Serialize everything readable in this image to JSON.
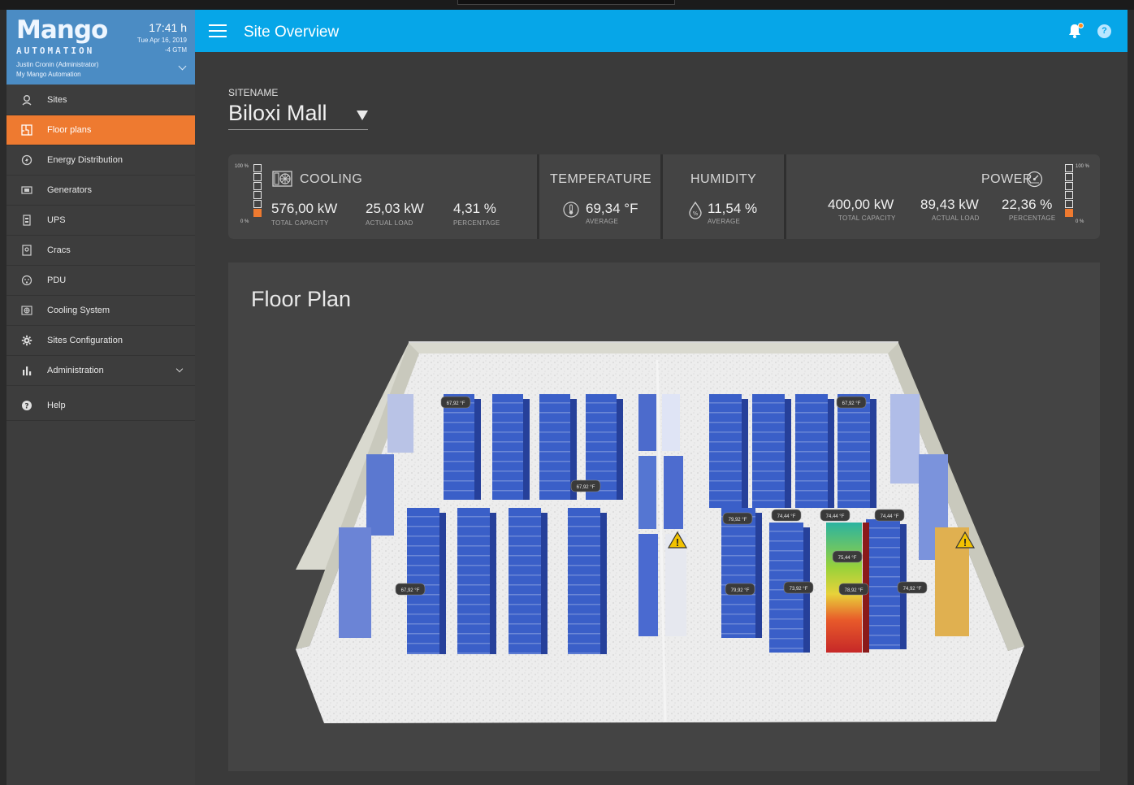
{
  "brand": {
    "logo": "Mango",
    "logo_sub": "AUTOMATION",
    "time": "17:41 h",
    "date": "Tue Apr 16, 2019",
    "timezone": "-4 GTM",
    "user": "Justin Cronin (Administrator)",
    "account": "My Mango Automation"
  },
  "nav": [
    {
      "label": "Sites",
      "icon": "location-pin-icon"
    },
    {
      "label": "Floor plans",
      "icon": "floor-plan-icon",
      "active": true
    },
    {
      "label": "Energy Distribution",
      "icon": "energy-icon"
    },
    {
      "label": "Generators",
      "icon": "generator-icon"
    },
    {
      "label": "UPS",
      "icon": "battery-icon"
    },
    {
      "label": "Cracs",
      "icon": "crac-icon"
    },
    {
      "label": "PDU",
      "icon": "pdu-icon"
    },
    {
      "label": "Cooling System",
      "icon": "cooling-icon"
    },
    {
      "label": "Sites Configuration",
      "icon": "gear-icon"
    },
    {
      "label": "Administration",
      "icon": "bar-chart-icon",
      "expandable": true
    },
    {
      "label": "Help",
      "icon": "help-circle-icon"
    }
  ],
  "header": {
    "title": "Site Overview",
    "help_label": "?"
  },
  "site": {
    "label": "SITENAME",
    "value": "Biloxi Mall"
  },
  "cooling": {
    "title": "COOLING",
    "total_capacity": "576,00 kW",
    "total_capacity_label": "TOTAL CAPACITY",
    "actual_load": "25,03 kW",
    "actual_load_label": "ACTUAL LOAD",
    "percentage": "4,31 %",
    "percentage_label": "PERCENTAGE",
    "meter_top": "100 %",
    "meter_bottom": "0 %",
    "meter_level": 0.043
  },
  "temperature": {
    "title": "TEMPERATURE",
    "value": "69,34 °F",
    "label": "AVERAGE"
  },
  "humidity": {
    "title": "HUMIDITY",
    "value": "11,54 %",
    "label": "AVERAGE"
  },
  "power": {
    "title": "POWER",
    "total_capacity": "400,00 kW",
    "total_capacity_label": "TOTAL CAPACITY",
    "actual_load": "89,43 kW",
    "actual_load_label": "ACTUAL LOAD",
    "percentage": "22,36 %",
    "percentage_label": "PERCENTAGE",
    "meter_top": "100 %",
    "meter_bottom": "0 %",
    "meter_level": 0.224
  },
  "floorplan": {
    "title": "Floor Plan",
    "sensors": [
      "67,92 °F",
      "67,92 °F",
      "67,92 °F",
      "67,92 °F",
      "79,92 °F",
      "74,44 °F",
      "74,44 °F",
      "74,44 °F",
      "75,44 °F",
      "79,92 °F",
      "73,92 °F",
      "78,92 °F",
      "74,92 °F"
    ],
    "colors": {
      "rack": "#3a5fc8",
      "rack_dark": "#26409a",
      "warning": "#f2c200",
      "floor": "#ececec",
      "hot": "#d42a1a"
    }
  }
}
